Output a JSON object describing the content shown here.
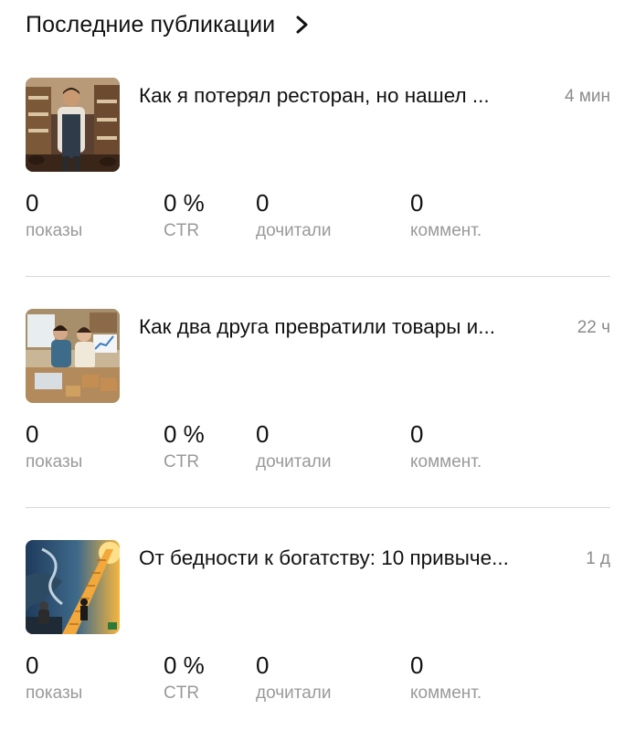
{
  "header": {
    "title": "Последние публикации",
    "chevron_icon": "chevron-right-icon"
  },
  "posts": [
    {
      "thumbnail": "image-man-in-shoe-store",
      "title": "Как я потерял ресторан, но нашел ...",
      "time": "4 мин",
      "stats": [
        {
          "value": "0",
          "label": "показы"
        },
        {
          "value": "0 %",
          "label": "CTR"
        },
        {
          "value": "0",
          "label": "дочитали"
        },
        {
          "value": "0",
          "label": "коммент."
        }
      ]
    },
    {
      "thumbnail": "image-two-friends-with-laptop",
      "title": "Как два друга превратили товары и...",
      "time": "22 ч",
      "stats": [
        {
          "value": "0",
          "label": "показы"
        },
        {
          "value": "0 %",
          "label": "CTR"
        },
        {
          "value": "0",
          "label": "дочитали"
        },
        {
          "value": "0",
          "label": "коммент."
        }
      ]
    },
    {
      "thumbnail": "image-path-to-wealth-stairs",
      "title": "От бедности к богатству: 10 привыче...",
      "time": "1 д",
      "stats": [
        {
          "value": "0",
          "label": "показы"
        },
        {
          "value": "0 %",
          "label": "CTR"
        },
        {
          "value": "0",
          "label": "дочитали"
        },
        {
          "value": "0",
          "label": "коммент."
        }
      ]
    }
  ]
}
